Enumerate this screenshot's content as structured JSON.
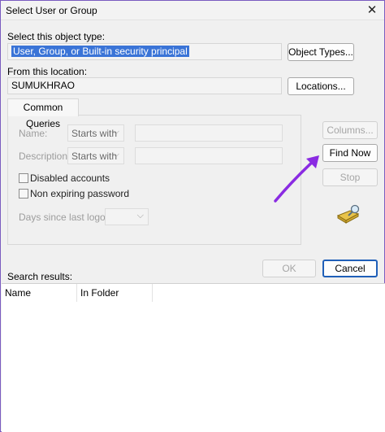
{
  "window": {
    "title": "Select User or Group",
    "close_glyph": "✕"
  },
  "object_type": {
    "label": "Select this object type:",
    "value": "User, Group, or Built-in security principal",
    "button": "Object Types..."
  },
  "location": {
    "label": "From this location:",
    "value": "SUMUKHRAO",
    "button": "Locations..."
  },
  "common_queries": {
    "tab_label": "Common Queries",
    "name_label": "Name:",
    "name_mode": "Starts with",
    "description_label": "Description:",
    "description_mode": "Starts with",
    "disabled_accounts_label": "Disabled accounts",
    "non_expiring_label": "Non expiring password",
    "days_since_label": "Days since last logon:"
  },
  "side_buttons": {
    "columns": "Columns...",
    "find_now": "Find Now",
    "stop": "Stop"
  },
  "footer": {
    "ok": "OK",
    "cancel": "Cancel"
  },
  "results": {
    "label": "Search results:",
    "columns": [
      "Name",
      "In Folder"
    ]
  },
  "colors": {
    "annotation_arrow": "#8a2be2",
    "selection": "#3a74d7"
  },
  "icons": {
    "search_icon": "flashlight-search-icon"
  }
}
